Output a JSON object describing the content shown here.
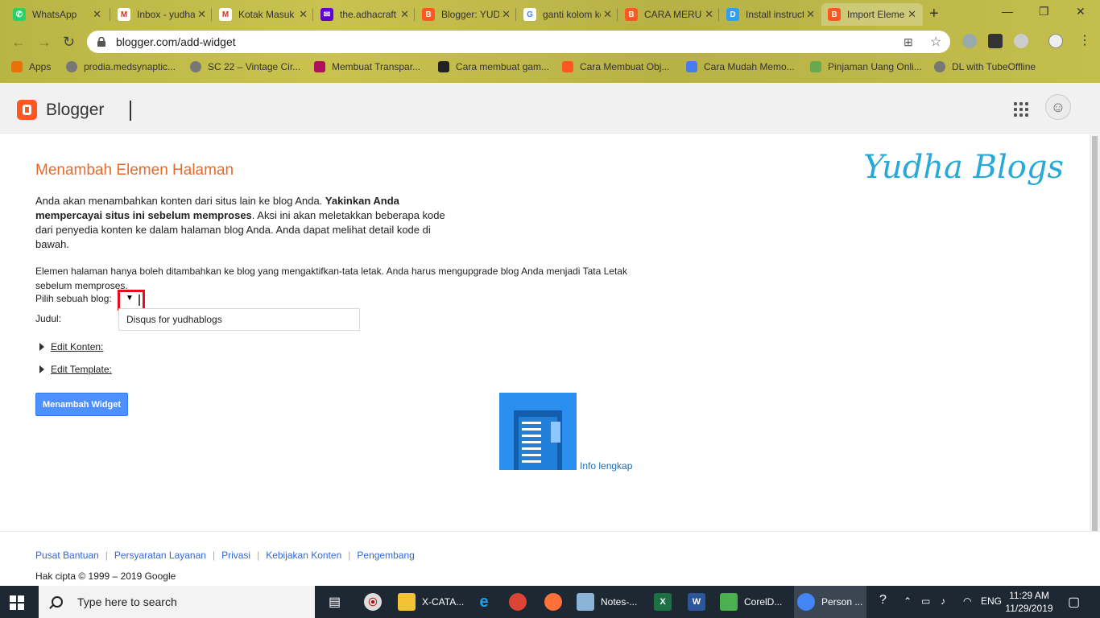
{
  "browser": {
    "tabs": [
      {
        "label": "WhatsApp",
        "icon": "whatsapp-icon",
        "color": "#25d366",
        "glyph": "W"
      },
      {
        "label": "Inbox - yudhaaditya",
        "icon": "gmail-icon",
        "color": "#d93025",
        "glyph": "M"
      },
      {
        "label": "Kotak Masuk",
        "icon": "gmail-icon",
        "color": "#d93025",
        "glyph": "M"
      },
      {
        "label": "the.adhacraft",
        "icon": "yahoo-mail-icon",
        "color": "#6001d2",
        "glyph": "✉"
      },
      {
        "label": "Blogger: YUDHA",
        "icon": "blogger-icon",
        "color": "#ff5722",
        "glyph": "B"
      },
      {
        "label": "ganti kolom komentar",
        "icon": "google-icon",
        "color": "#ffffff",
        "glyph": "G"
      },
      {
        "label": "CARA MERUBAH",
        "icon": "blogger-icon",
        "color": "#ff5722",
        "glyph": "B"
      },
      {
        "label": "Install instructions",
        "icon": "disqus-icon",
        "color": "#2e9fff",
        "glyph": "D"
      },
      {
        "label": "Import Elemen",
        "icon": "blogger-icon",
        "color": "#ff5722",
        "glyph": "B"
      }
    ],
    "new_tab": "+",
    "url": "blogger.com/add-widget",
    "bookmarks": [
      {
        "label": "Apps",
        "color": "#e8710a"
      },
      {
        "label": "prodia.medsynaptic...",
        "color": "#777777"
      },
      {
        "label": "SC 22 – Vintage Cir...",
        "color": "#777777"
      },
      {
        "label": "Membuat Transpar...",
        "color": "#b0115d"
      },
      {
        "label": "Cara membuat gam...",
        "color": "#222222"
      },
      {
        "label": "Cara Membuat Obj...",
        "color": "#ff5722"
      },
      {
        "label": "Cara Mudah Memo...",
        "color": "#4a7af0"
      },
      {
        "label": "Pinjaman Uang Onli...",
        "color": "#6aa84f"
      },
      {
        "label": "DL with TubeOffline",
        "color": "#777777"
      }
    ]
  },
  "header": {
    "brand": "Blogger"
  },
  "main": {
    "title": "Menambah Elemen Halaman",
    "brand_script": "Yudha Blogs",
    "para1_a": "Anda akan menambahkan konten dari situs lain ke blog Anda. ",
    "para1_bold": "Yakinkan Anda mempercayai situs ini sebelum memproses",
    "para1_b": ". Aksi ini akan meletakkan beberapa kode dari penyedia konten ke dalam halaman blog Anda. Anda dapat melihat detail kode di bawah.",
    "para2": "Elemen halaman hanya boleh ditambahkan ke blog yang mengaktifkan-tata letak. Anda harus mengupgrade blog Anda menjadi Tata Letak sebelum memproses.",
    "blog_label": "Pilih sebuah blog:",
    "judul_label": "Judul:",
    "judul_value": "Disqus for yudhablogs",
    "edit_konten": "Edit Konten:",
    "edit_template": "Edit Template:",
    "add_button": "Menambah Widget",
    "info_link": "Info lengkap"
  },
  "footer": {
    "links": [
      "Pusat Bantuan",
      "Persyaratan Layanan",
      "Privasi",
      "Kebijakan Konten",
      "Pengembang"
    ],
    "copyright": "Hak cipta © 1999 – 2019 Google"
  },
  "taskbar": {
    "search_placeholder": "Type here to search",
    "items": [
      {
        "label": "X-CATA...",
        "icon": "folder-icon",
        "color": "#f2c335"
      },
      {
        "label": "Notes-...",
        "icon": "notes-icon",
        "color": "#8ab4d8"
      },
      {
        "label": "CorelD...",
        "icon": "coreldraw-icon",
        "color": "#4caf50"
      },
      {
        "label": "Person ...",
        "icon": "chrome-icon",
        "color": "#4285f4"
      }
    ],
    "language": "ENG",
    "time": "11:29 AM",
    "date": "11/29/2019"
  }
}
